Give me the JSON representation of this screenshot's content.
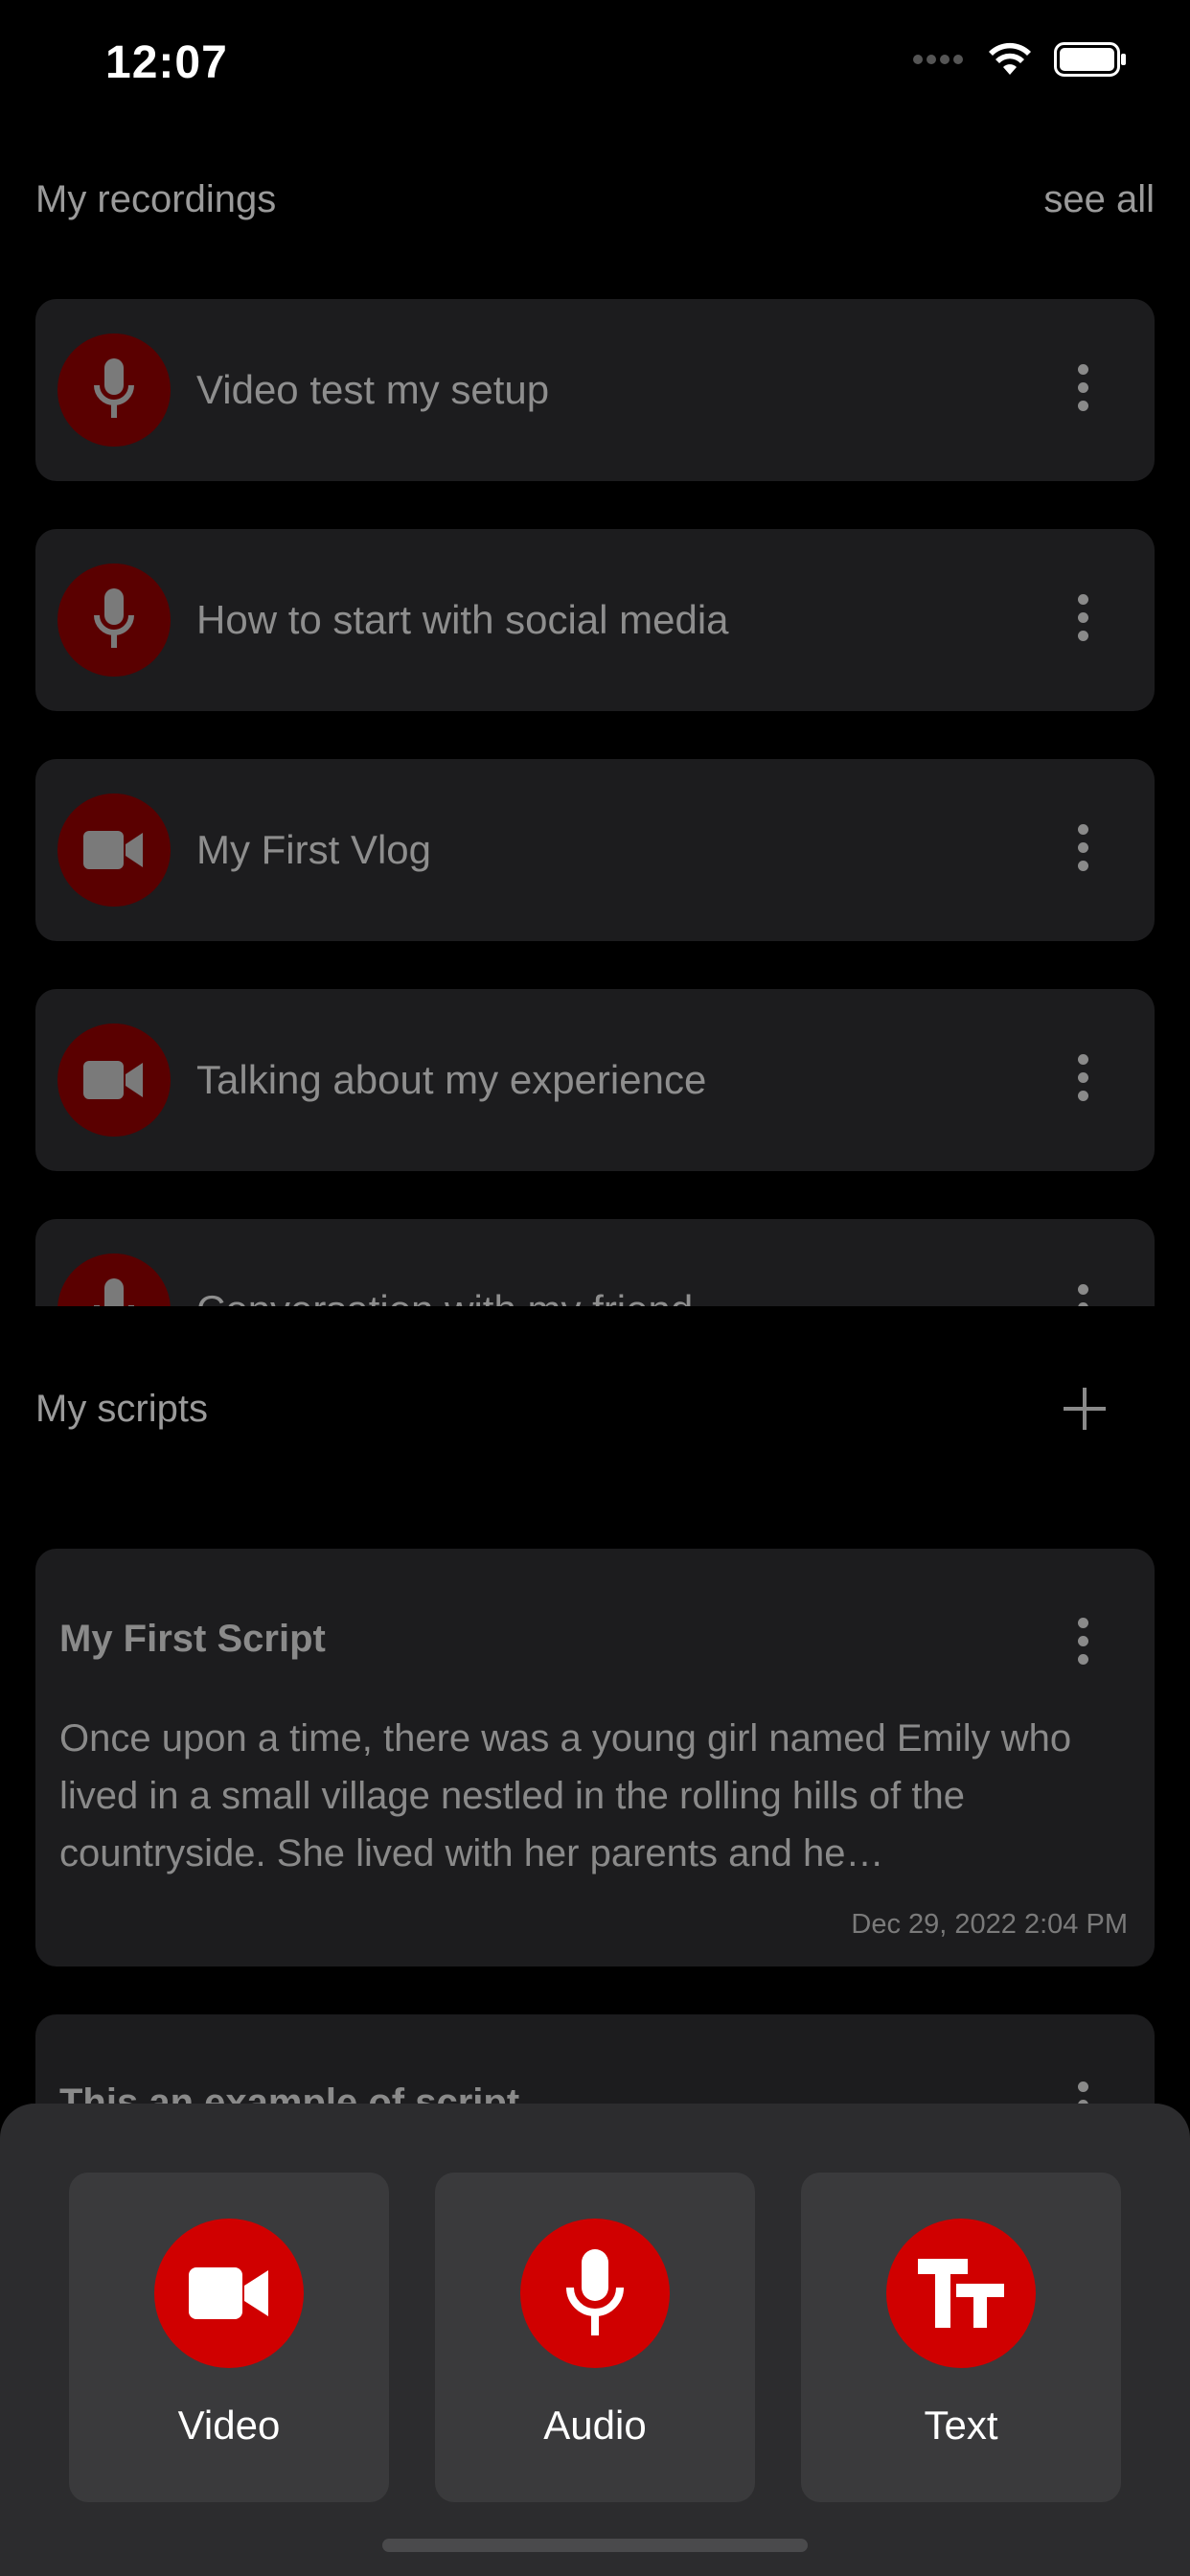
{
  "status_bar": {
    "time": "12:07"
  },
  "recordings": {
    "title": "My recordings",
    "see_all": "see all",
    "items": [
      {
        "type": "audio",
        "icon": "microphone-icon",
        "title": "Video test my setup"
      },
      {
        "type": "audio",
        "icon": "microphone-icon",
        "title": "How to start with social media"
      },
      {
        "type": "video",
        "icon": "video-camera-icon",
        "title": "My First Vlog"
      },
      {
        "type": "video",
        "icon": "video-camera-icon",
        "title": "Talking about my experience"
      },
      {
        "type": "audio",
        "icon": "microphone-icon",
        "title": "Conversation with my friend"
      }
    ]
  },
  "scripts": {
    "title": "My scripts",
    "items": [
      {
        "title": "My First Script",
        "body": "Once upon a time, there was a young girl named Emily who lived in a small village nestled in the rolling hills of the countryside. She lived with her parents and he…",
        "date": "Dec 29, 2022 2:04 PM"
      },
      {
        "title": "This an example of script"
      }
    ]
  },
  "create_sheet": {
    "options": [
      {
        "label": "Video",
        "icon": "video-camera-icon"
      },
      {
        "label": "Audio",
        "icon": "microphone-icon"
      },
      {
        "label": "Text",
        "icon": "text-size-icon"
      }
    ]
  },
  "colors": {
    "accent": "#d00000",
    "accent_dim": "#5a0000",
    "card_background": "#1c1c1e",
    "sheet_background": "#2c2c2e"
  }
}
